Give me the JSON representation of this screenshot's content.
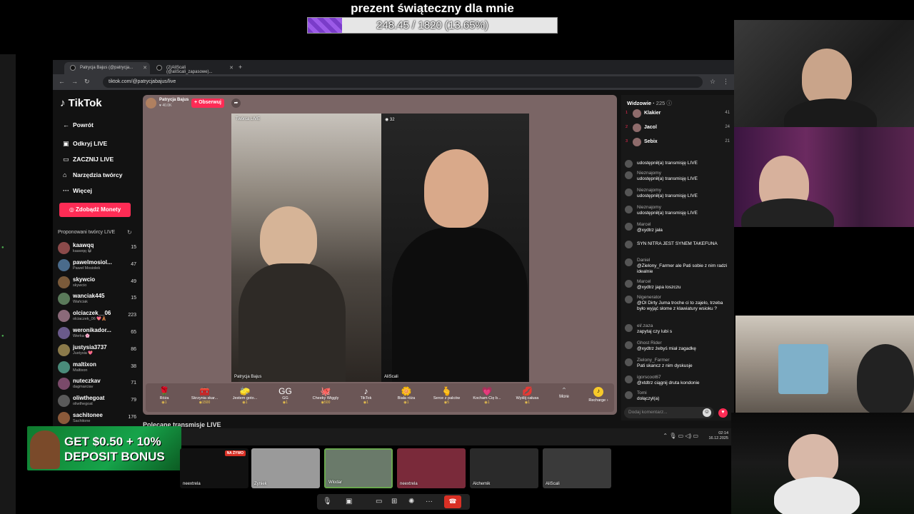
{
  "goal": {
    "title": "prezent świąteczny dla mnie",
    "progress_text": "248.45 / 1820 (13.65%)",
    "progress_fraction": 0.1365,
    "fill_color": "#8a47d9"
  },
  "browser": {
    "tabs": [
      {
        "title": "Patrycja Bajus (@patrycja..."
      },
      {
        "title": "(2)AliScali (@aliScali_zapasowe)..."
      }
    ],
    "new_tab_icon": "plus-icon",
    "url": "tiktok.com/@patrycjabajus/live"
  },
  "tiktok": {
    "logo": "TikTok",
    "nav": [
      {
        "label": "Powrót",
        "icon": "arrow-left-icon"
      },
      {
        "label": "Odkryj LIVE",
        "icon": "live-icon"
      },
      {
        "label": "ZACZNIJ LIVE",
        "icon": "camera-icon"
      },
      {
        "label": "Narzędzia twórcy",
        "icon": "lightbulb-icon"
      },
      {
        "label": "Więcej",
        "icon": "dots-icon"
      }
    ],
    "coins_button": "Zdobądź Monety",
    "suggested_title": "Proponowani twórcy LIVE",
    "creators": [
      {
        "name": "kaawqq",
        "sub": "kaawqq 😀",
        "count": "15"
      },
      {
        "name": "pawelmosiol...",
        "sub": "Paweł Mosiołek",
        "count": "47"
      },
      {
        "name": "skywcio",
        "sub": "skywcio",
        "count": "49"
      },
      {
        "name": "wanciak445",
        "sub": "Wańciak",
        "count": "15"
      },
      {
        "name": "olciaczek__06",
        "sub": "olciaczek_06 💖🧸",
        "count": "223"
      },
      {
        "name": "weronikador...",
        "sub": "Werka 🌸",
        "count": "65"
      },
      {
        "name": "justysia3737",
        "sub": "Justysia 💖",
        "count": "86"
      },
      {
        "name": "maltixon",
        "sub": "Maltixon",
        "count": "38"
      },
      {
        "name": "nuteczkav",
        "sub": "dagmarciav",
        "count": "71"
      },
      {
        "name": "oliwthegoat",
        "sub": "oliwthegoat",
        "count": "79"
      },
      {
        "name": "sachitonee",
        "sub": "Sachitone",
        "count": "176"
      }
    ],
    "host": {
      "name": "Patrycja Bajus",
      "likes": "40.0K",
      "follow_label": "+ Obserwuj"
    },
    "video1_top_label": "Twórca LIVE",
    "video1_name": "Patrycja Bajus",
    "video2_score": "32",
    "video2_name": "AliScali",
    "gifts": [
      {
        "name": "Róża",
        "price": "1",
        "glyph": "🌹"
      },
      {
        "name": "Skrzynia skar...",
        "price": "1500",
        "glyph": "🧰"
      },
      {
        "name": "Jestem goto...",
        "price": "1",
        "glyph": "🧽"
      },
      {
        "name": "GG",
        "price": "1",
        "glyph": "GG"
      },
      {
        "name": "Cheeky Wiggly",
        "price": "500",
        "glyph": "🐙"
      },
      {
        "name": "TikTok",
        "price": "1",
        "glyph": "♪"
      },
      {
        "name": "Biała róża",
        "price": "1",
        "glyph": "🌼"
      },
      {
        "name": "Serce z palców",
        "price": "5",
        "glyph": "🫰"
      },
      {
        "name": "Kocham Cię b...",
        "price": "1",
        "glyph": "💗"
      },
      {
        "name": "Wyślij całusa",
        "price": "1",
        "glyph": "💋"
      }
    ],
    "more_label": "More",
    "recharge_label": "Recharge",
    "recommended_title": "Polecane transmisje LIVE",
    "viewers_title": "Widzowie",
    "viewers_count": "225",
    "top_viewers": [
      {
        "rank": "1",
        "name": "Klakier",
        "count": "41"
      },
      {
        "rank": "2",
        "name": "Jacol",
        "count": "24"
      },
      {
        "rank": "3",
        "name": "Sebix",
        "count": "21"
      }
    ],
    "chat": [
      {
        "user": "",
        "text": "udostępnił(a) transmisję LIVE"
      },
      {
        "user": "Nieznajomy",
        "text": "udostępnił(a) transmisję LIVE"
      },
      {
        "user": "Nieznajomy",
        "text": "udostępnił(a) transmisję LIVE"
      },
      {
        "user": "Nieznajomy",
        "text": "udostępnił(a) transmisję LIVE"
      },
      {
        "user": "Marcel",
        "text": "@xydtrz jała"
      },
      {
        "user": "",
        "text": "SYN NITRA JEST SYNEM TAKEFUNA"
      },
      {
        "user": "Daniel",
        "text": "@Zielony_Farmer ale Pati sobie z nim radzi idealnie"
      },
      {
        "user": "Marcel",
        "text": "@xydtrz japa loszczu"
      },
      {
        "user": "Nigenerator",
        "text": "@OI Dirty Juma troche ci to zajelo, trzeba było wyjąć słome z klawiatury wsioku ?"
      },
      {
        "user": "el/.zaza",
        "text": "zapytaj czy lubi s"
      },
      {
        "user": "Ghost Rider",
        "text": "@xydtrz żebyś miał zagadkę"
      },
      {
        "user": "Zielony_Farmer",
        "text": "Pati skancz z nim dyskusje"
      },
      {
        "user": "igorscoot67",
        "text": "@xtdtrz ciągnij druta kondonie"
      },
      {
        "user": "Tomi",
        "text": "dołączył(a)"
      }
    ],
    "comment_placeholder": "Dodaj komentarz..."
  },
  "taskbar": {
    "time": "02:14",
    "date": "16.12.2025"
  },
  "ad": {
    "line1": "GET $0.50 + 10%",
    "line2": "DEPOSIT BONUS"
  },
  "call": {
    "tiles": [
      {
        "name": "neextrela",
        "badge": "NA ŻYWO"
      },
      {
        "name": "Zyniek"
      },
      {
        "name": "Wlodar"
      },
      {
        "name": "neextrela"
      },
      {
        "name": "Alchemik"
      },
      {
        "name": "AliScali"
      }
    ]
  }
}
